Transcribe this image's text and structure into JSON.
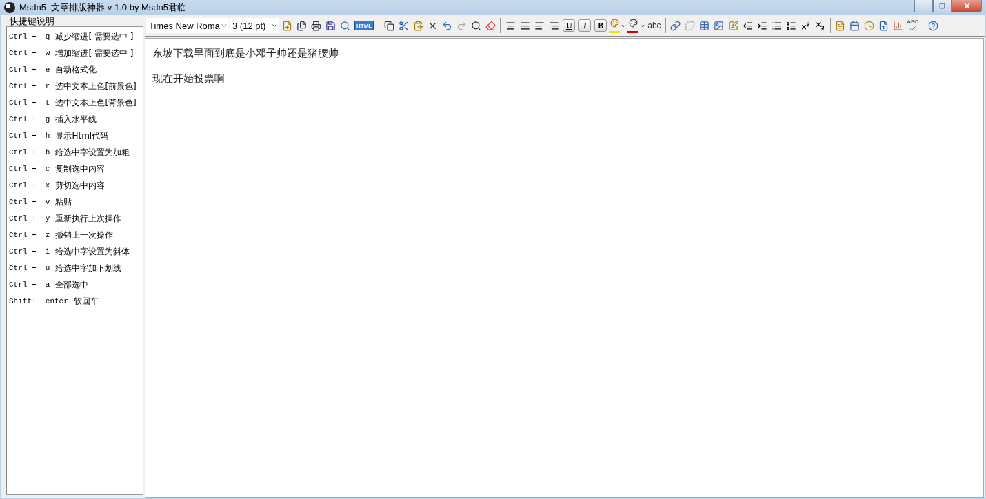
{
  "window": {
    "title": "Msdn5  文章排版神器 v 1.0 by Msdn5君临"
  },
  "shortcuts": {
    "title": "快捷键说明",
    "items": [
      {
        "keys": "Ctrl +  q",
        "action": "减少缩进[ 需要选中 ]"
      },
      {
        "keys": "Ctrl +  w",
        "action": "增加缩进[ 需要选中 ]"
      },
      {
        "keys": "Ctrl +  e",
        "action": "自动格式化"
      },
      {
        "keys": "Ctrl +  r",
        "action": "选中文本上色[前景色]"
      },
      {
        "keys": "Ctrl +  t",
        "action": "选中文本上色[背景色]"
      },
      {
        "keys": "Ctrl +  g",
        "action": "插入水平线"
      },
      {
        "keys": "Ctrl +  h",
        "action": "显示Html代码"
      },
      {
        "keys": "Ctrl +  b",
        "action": "给选中字设置为加粗"
      },
      {
        "keys": "Ctrl +  c",
        "action": "复制选中内容"
      },
      {
        "keys": "Ctrl +  x",
        "action": "剪切选中内容"
      },
      {
        "keys": "Ctrl +  v",
        "action": "粘贴"
      },
      {
        "keys": "Ctrl +  y",
        "action": "重新执行上次操作"
      },
      {
        "keys": "Ctrl +  z",
        "action": "撤销上一次操作"
      },
      {
        "keys": "Ctrl +  i",
        "action": "给选中字设置为斜体"
      },
      {
        "keys": "Ctrl +  u",
        "action": "给选中字加下划线"
      },
      {
        "keys": "Ctrl +  a",
        "action": "全部选中"
      },
      {
        "keys": "Shift+  enter",
        "action": "软回车"
      }
    ]
  },
  "toolbar": {
    "font": "Times New Roma",
    "size": "3 (12 pt)",
    "html_label": "HTML",
    "format_buttons": [
      "U",
      "I",
      "B"
    ],
    "strike_label": "abc",
    "spell_label": "ABC"
  },
  "editor": {
    "paragraphs": [
      "东坡下载里面到底是小邓子帅还是猪腰帅",
      "现在开始投票啊"
    ]
  }
}
